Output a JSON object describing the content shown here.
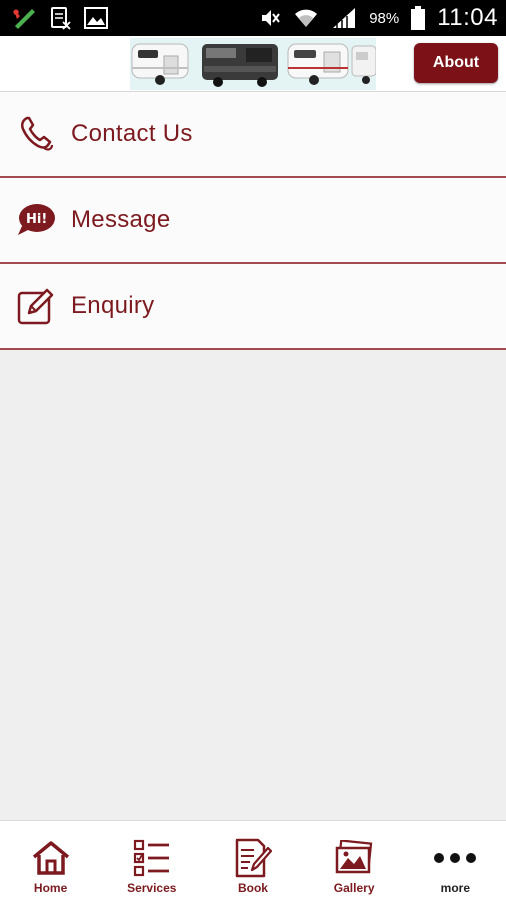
{
  "status_bar": {
    "battery": "98%",
    "time": "11:04",
    "icons": [
      "app-icon",
      "sim-icon",
      "image-icon",
      "mute-icon",
      "wifi-icon",
      "signal-icon",
      "battery-icon"
    ]
  },
  "header": {
    "banner_icon": "caravan-banner-image",
    "about_label": "About"
  },
  "list": {
    "items": [
      {
        "label": "Contact Us",
        "icon": "phone-icon"
      },
      {
        "label": "Message",
        "icon": "chat-bubble-icon"
      },
      {
        "label": "Enquiry",
        "icon": "edit-icon"
      }
    ]
  },
  "bottom_nav": {
    "items": [
      {
        "label": "Home",
        "icon": "home-icon"
      },
      {
        "label": "Services",
        "icon": "list-icon"
      },
      {
        "label": "Book",
        "icon": "book-icon"
      },
      {
        "label": "Gallery",
        "icon": "gallery-icon"
      },
      {
        "label": "more",
        "icon": "more-icon"
      }
    ]
  },
  "colors": {
    "accent": "#7c1217",
    "text_accent": "#7c1a1f",
    "background": "#efefef"
  }
}
